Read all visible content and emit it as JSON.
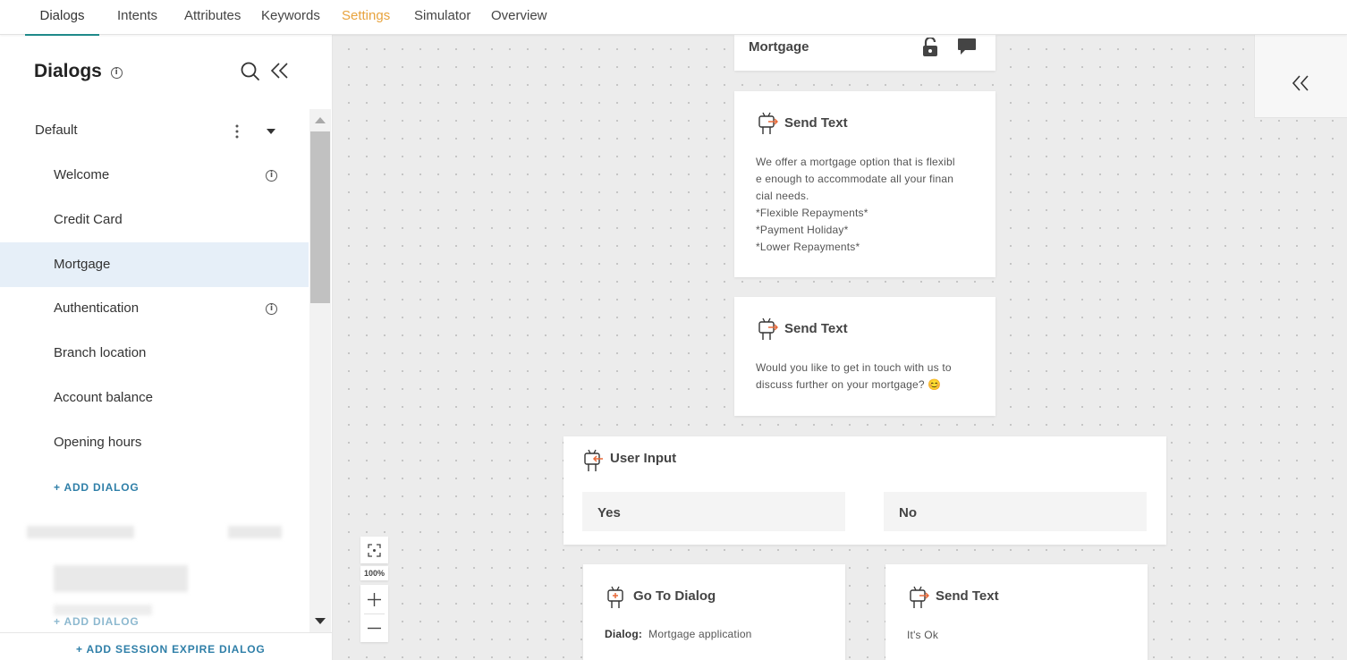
{
  "nav": {
    "tabs": [
      {
        "label": "Dialogs"
      },
      {
        "label": "Intents"
      },
      {
        "label": "Attributes"
      },
      {
        "label": "Keywords"
      },
      {
        "label": "Settings"
      },
      {
        "label": "Simulator"
      },
      {
        "label": "Overview"
      }
    ],
    "active_color": "#1f8a8a",
    "settings_color": "#e8a33d"
  },
  "sidebar": {
    "title": "Dialogs",
    "group": {
      "label": "Default"
    },
    "items": [
      {
        "label": "Welcome",
        "has_info": true
      },
      {
        "label": "Credit Card",
        "has_info": false
      },
      {
        "label": "Mortgage",
        "has_info": false,
        "selected": true
      },
      {
        "label": "Authentication",
        "has_info": true
      },
      {
        "label": "Branch location",
        "has_info": false
      },
      {
        "label": "Account balance",
        "has_info": false
      },
      {
        "label": "Opening hours",
        "has_info": false
      }
    ],
    "add_dialog": "+ ADD DIALOG",
    "add_dialog_2": "+ ADD DIALOG",
    "add_session_expire": "+ ADD SESSION EXPIRE DIALOG",
    "selected_color": "#e6eff8"
  },
  "canvas": {
    "header_node": {
      "title": "Mortgage",
      "icons": [
        "lock-open-icon",
        "comment-icon"
      ]
    },
    "send_text_1": {
      "title": "Send Text",
      "body": "We offer a mortgage option that is flexibl\ne enough to accommodate all your finan\ncial needs.\n*Flexible Repayments*\n*Payment Holiday*\n*Lower Repayments*"
    },
    "send_text_2": {
      "title": "Send Text",
      "body": "Would you like to get in touch with us to\ndiscuss further on your mortgage? 😊"
    },
    "user_input": {
      "title": "User Input",
      "options": [
        "Yes",
        "No"
      ]
    },
    "go_to_dialog": {
      "title": "Go To Dialog",
      "dialog_label": "Dialog:",
      "dialog_value": "Mortgage application"
    },
    "send_text_3": {
      "title": "Send Text",
      "body": "It's Ok"
    },
    "zoom": {
      "level": "100%"
    }
  }
}
